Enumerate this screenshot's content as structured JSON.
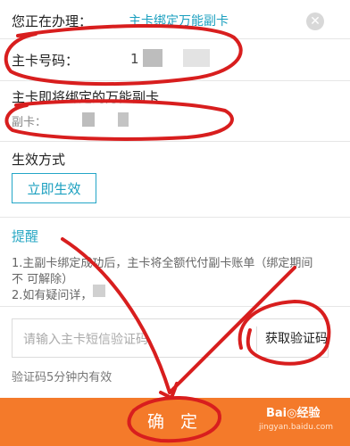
{
  "header": {
    "handling_label": "您正在办理：",
    "handling_value": "主卡绑定万能副卡",
    "close_glyph": "✕"
  },
  "main_card": {
    "label": "主卡号码：",
    "value_prefix": "1"
  },
  "bind_section": {
    "title": "主卡即将绑定的万能副卡",
    "sub_label": "副卡："
  },
  "effect": {
    "title": "生效方式",
    "button_label": "立即生效"
  },
  "notice": {
    "title": "提醒",
    "line1": "1.主副卡绑定成功后，主卡将全额代付副卡账单（绑定期间",
    "line2": "不 可解除）",
    "line3": "2.如有疑问详，"
  },
  "verify": {
    "placeholder": "请输入主卡短信验证码",
    "get_code_label": "获取验证码",
    "hint": "验证码5分钟内有效"
  },
  "footer": {
    "confirm_label": "确 定",
    "watermark": "Bai◎经验",
    "watermark_sub": "jingyan.baidu.com",
    "bg_color": "#f47a2a"
  },
  "colors": {
    "accent": "#1a9fbf",
    "annotation_ink": "#d81e1e"
  }
}
